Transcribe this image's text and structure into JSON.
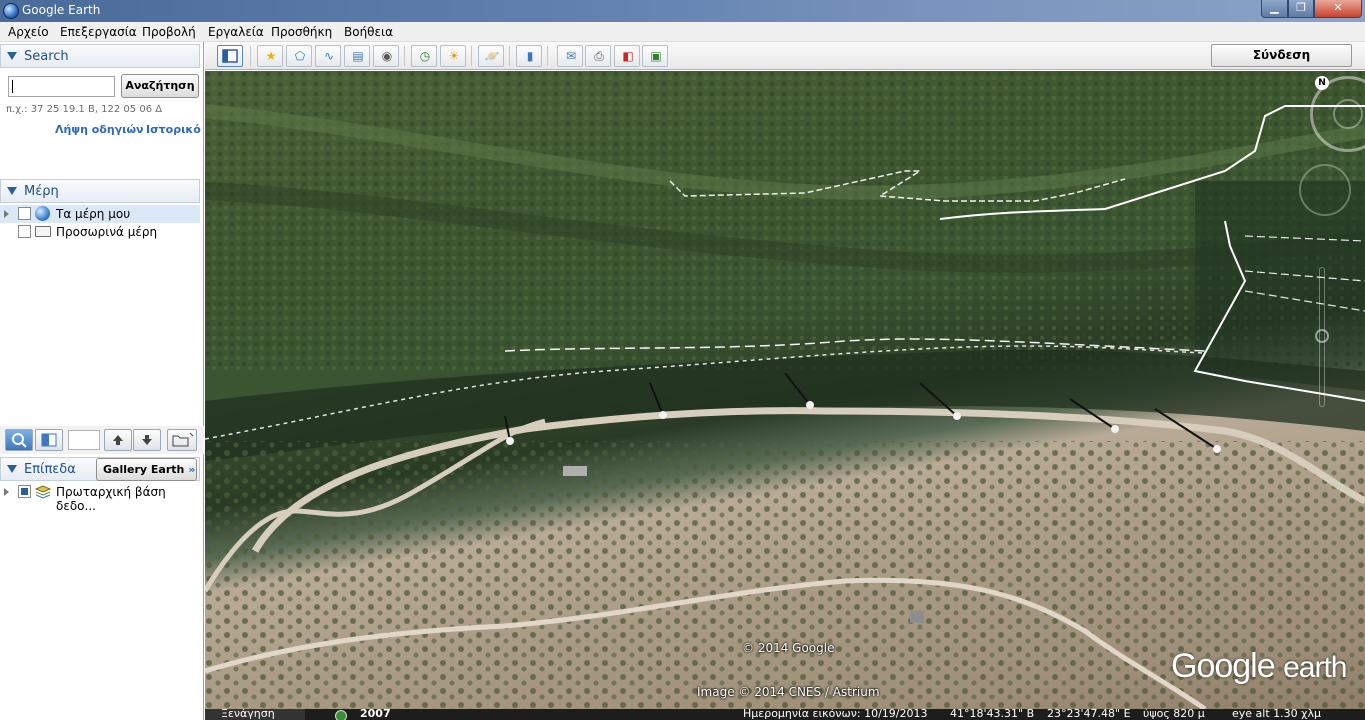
{
  "window": {
    "title": "Google Earth",
    "icons": {
      "app": "google-earth-globe-icon",
      "minimize": "minimize-icon",
      "maximize": "maximize-icon",
      "close": "close-icon"
    },
    "buttons": {
      "minimize": "▁",
      "maximize": "❐",
      "close": "✕"
    }
  },
  "menu": [
    "Αρχείο",
    "Επεξεργασία",
    "Προβολή",
    "Εργαλεία",
    "Προσθήκη",
    "Βοήθεια"
  ],
  "search": {
    "header": "Search",
    "input_value": "",
    "button": "Αναζήτηση",
    "hint": "π.χ.: 37 25 19.1 Β, 122 05 06 Δ",
    "link_directions": "Λήψη οδηγιών",
    "link_history": "Ιστορικό"
  },
  "places": {
    "header": "Μέρη",
    "items": [
      {
        "label": "Τα μέρη μου",
        "icon": "globe-icon",
        "selected": true
      },
      {
        "label": "Προσωρινά μέρη",
        "icon": "folder-icon",
        "selected": false
      }
    ]
  },
  "panel_tools": [
    "search-tool-icon",
    "sidebar-toggle-icon",
    "move-up-icon",
    "move-down-icon",
    "new-folder-icon"
  ],
  "layers": {
    "header": "Επίπεδα",
    "gallery_button": "Gallery Earth",
    "gallery_chevron": "»",
    "items": [
      {
        "label": "Πρωταρχική βάση δεδο...",
        "icon": "layers-stack-icon"
      }
    ]
  },
  "toolbar": {
    "signin": "Σύνδεση",
    "buttons": [
      "sidebar-icon",
      "placemark-icon",
      "polygon-icon",
      "path-icon",
      "image-overlay-icon",
      "record-tour-icon",
      "historical-imagery-icon",
      "sunlight-icon",
      "planets-icon",
      "ruler-icon",
      "email-icon",
      "print-icon",
      "view-in-maps-icon",
      "save-image-icon"
    ]
  },
  "map": {
    "copyright": "© 2014 Google",
    "image_credit": "Image © 2014 CNES / Astrium",
    "logo_google": "Google",
    "logo_earth": "earth",
    "compass_label": "N"
  },
  "statusbar": {
    "tour": "Ξενάγηση",
    "year": "2007",
    "imagery_date": "Ημερομηνία εικόνων: 10/19/2013",
    "lat": "41°18'43.31\" Β",
    "lon": "23°23'47.48\" Ε",
    "elevation": "ύψος   820 μ",
    "eye_alt": "eye alt   1.30 χλμ"
  },
  "colors": {
    "link": "#2e6bb7",
    "header_text": "#1f4e8a",
    "titlebar": "#5f7fae"
  }
}
